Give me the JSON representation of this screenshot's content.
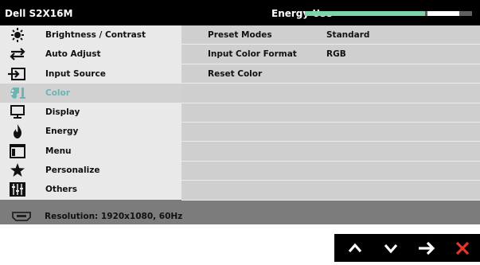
{
  "header": {
    "model": "Dell S2X16M",
    "energy_label": "Energy Use",
    "energy_level": 0.72,
    "energy_peak": 0.19,
    "energy_color": "#7fd3a8"
  },
  "menu": {
    "selected_index": 3,
    "accent_color": "#6db4b4",
    "items": [
      {
        "label": "Brightness / Contrast",
        "icon": "sun-icon"
      },
      {
        "label": "Auto Adjust",
        "icon": "auto-adjust-arrows-icon"
      },
      {
        "label": "Input Source",
        "icon": "input-source-icon"
      },
      {
        "label": "Color",
        "icon": "color-palette-icon"
      },
      {
        "label": "Display",
        "icon": "monitor-icon"
      },
      {
        "label": "Energy",
        "icon": "flame-icon"
      },
      {
        "label": "Menu",
        "icon": "menu-window-icon"
      },
      {
        "label": "Personalize",
        "icon": "star-icon"
      },
      {
        "label": "Others",
        "icon": "sliders-icon"
      }
    ]
  },
  "panel": {
    "rows": [
      {
        "label": "Preset Modes",
        "value": "Standard"
      },
      {
        "label": "Input Color Format",
        "value": "RGB"
      },
      {
        "label": "Reset Color",
        "value": ""
      },
      {
        "label": "",
        "value": ""
      },
      {
        "label": "",
        "value": ""
      },
      {
        "label": "",
        "value": ""
      },
      {
        "label": "",
        "value": ""
      },
      {
        "label": "",
        "value": ""
      },
      {
        "label": "",
        "value": ""
      }
    ]
  },
  "status": {
    "icon": "hdmi-connector-icon",
    "text": "Resolution: 1920x1080, 60Hz"
  },
  "keys": [
    {
      "name": "up-button",
      "icon": "up-chevron-icon"
    },
    {
      "name": "down-button",
      "icon": "down-chevron-icon"
    },
    {
      "name": "next-button",
      "icon": "right-arrow-icon"
    },
    {
      "name": "exit-button",
      "icon": "close-icon",
      "color": "#e8332f"
    }
  ]
}
